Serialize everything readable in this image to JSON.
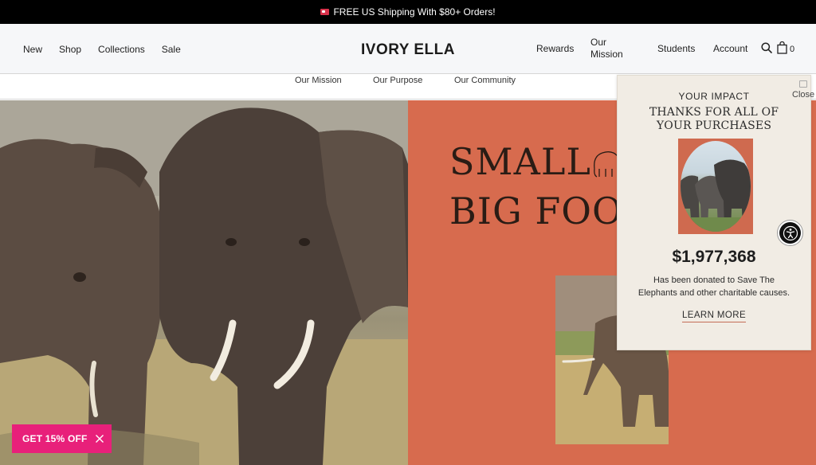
{
  "announcement": {
    "text": "FREE US Shipping With $80+ Orders!",
    "flag_icon": "heart-flag-icon"
  },
  "header": {
    "logo": "IVORY ELLA",
    "nav_left": [
      "New",
      "Shop",
      "Collections",
      "Sale"
    ],
    "nav_right": {
      "rewards": "Rewards",
      "our_mission": "Our Mission",
      "students": "Students",
      "account": "Account"
    },
    "cart_count": "0",
    "icons": [
      "search-icon",
      "shopping-bag-icon"
    ]
  },
  "subnav": [
    "Our Mission",
    "Our Purpose",
    "Our Community"
  ],
  "hero": {
    "headline_line1": "SMALL",
    "headline_line2": "BIG FOOT",
    "accent_color": "#d76b4e"
  },
  "impact_popup": {
    "close_label": "Close",
    "eyebrow": "YOUR IMPACT",
    "thanks_line1": "THANKS FOR ALL OF",
    "thanks_line2": "YOUR PURCHASES",
    "amount": "$1,977,368",
    "desc_line1": "Has been donated to Save The",
    "desc_line2": "Elephants and other charitable causes.",
    "learn_more": "LEARN MORE"
  },
  "discount": {
    "label": "GET 15% OFF",
    "color": "#e8207a"
  },
  "accessibility": {
    "icon": "accessibility-icon"
  }
}
